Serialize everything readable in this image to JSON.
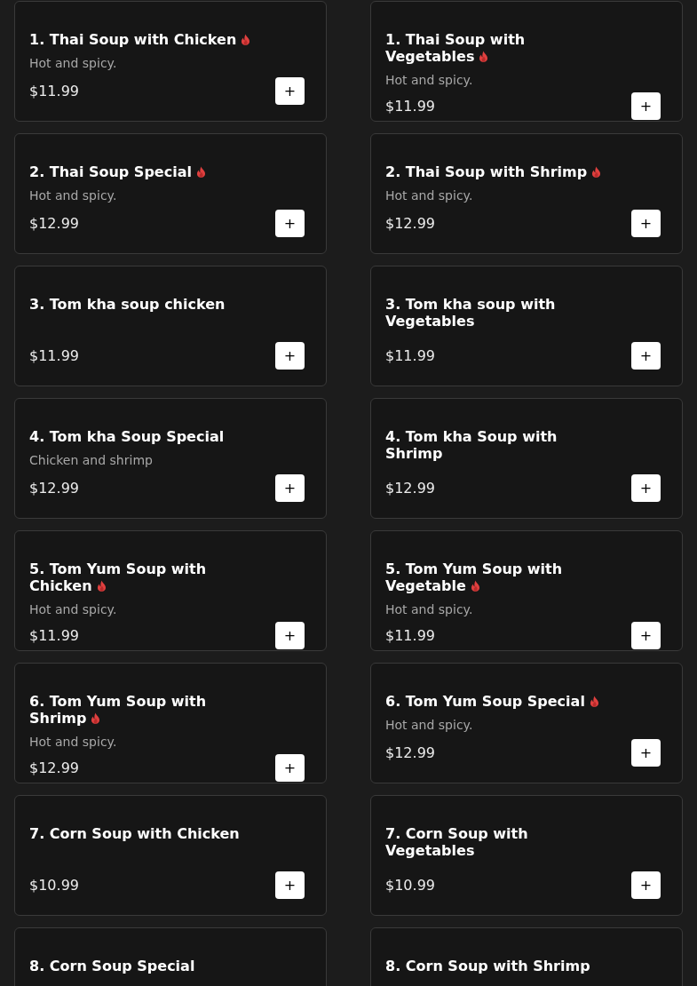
{
  "menu_items": [
    {
      "title": "1. Thai Soup with Chicken",
      "spicy": true,
      "description": "Hot and spicy.",
      "price": "$11.99",
      "add_button": "+"
    },
    {
      "title": "1. Thai Soup with Vegetables",
      "spicy": true,
      "description": "Hot and spicy.",
      "price": "$11.99",
      "add_button": "+"
    },
    {
      "title": "2. Thai Soup Special",
      "spicy": true,
      "description": "Hot and spicy.",
      "price": "$12.99",
      "add_button": "+"
    },
    {
      "title": "2. Thai Soup with Shrimp",
      "spicy": true,
      "description": "Hot and spicy.",
      "price": "$12.99",
      "add_button": "+"
    },
    {
      "title": "3. Tom kha soup chicken",
      "spicy": false,
      "price": "$11.99",
      "add_button": "+"
    },
    {
      "title": "3. Tom kha soup with Vegetables",
      "spicy": false,
      "price": "$11.99",
      "add_button": "+"
    },
    {
      "title": "4. Tom kha Soup Special",
      "spicy": false,
      "description": "Chicken and shrimp",
      "price": "$12.99",
      "add_button": "+"
    },
    {
      "title": "4. Tom kha Soup with Shrimp",
      "spicy": false,
      "price": "$12.99",
      "add_button": "+"
    },
    {
      "title": "5. Tom Yum Soup with Chicken",
      "spicy": true,
      "description": "Hot and spicy.",
      "price": "$11.99",
      "add_button": "+"
    },
    {
      "title": "5. Tom Yum Soup with Vegetable",
      "spicy": true,
      "description": "Hot and spicy.",
      "price": "$11.99",
      "add_button": "+"
    },
    {
      "title": "6. Tom Yum Soup with Shrimp",
      "spicy": true,
      "description": "Hot and spicy.",
      "price": "$12.99",
      "add_button": "+"
    },
    {
      "title": "6. Tom Yum Soup Special",
      "spicy": true,
      "description": "Hot and spicy.",
      "price": "$12.99",
      "add_button": "+"
    },
    {
      "title": "7. Corn Soup with Chicken",
      "spicy": false,
      "price": "$10.99",
      "add_button": "+"
    },
    {
      "title": "7. Corn Soup with Vegetables",
      "spicy": false,
      "price": "$10.99",
      "add_button": "+"
    },
    {
      "title": "8. Corn Soup Special",
      "spicy": false
    },
    {
      "title": "8. Corn Soup with Shrimp",
      "spicy": false
    }
  ]
}
